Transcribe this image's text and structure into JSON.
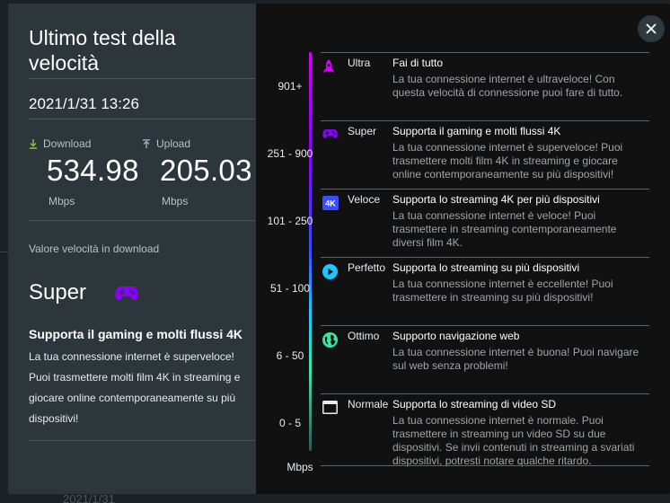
{
  "backdrop": {
    "date_text": "2021/1/31"
  },
  "summary": {
    "title": "Ultimo test della velocità",
    "timestamp": "2021/1/31 13:26",
    "download": {
      "label": "Download",
      "value": "534.98",
      "unit": "Mbps"
    },
    "upload": {
      "label": "Upload",
      "value": "205.03",
      "unit": "Mbps"
    },
    "section_label": "Valore velocità in download",
    "level_name": "Super",
    "level_title": "Supporta il gaming e molti flussi 4K",
    "level_description": "La tua connessione internet è superveloce! Puoi trasmettere molti film 4K in streaming e giocare online contemporaneamente su più dispositivi!"
  },
  "scale": {
    "labels": [
      "901+",
      "251 - 900",
      "101 - 250",
      "51 - 100",
      "6 - 50",
      "0 - 5"
    ],
    "unit": "Mbps"
  },
  "tiers": [
    {
      "name": "Ultra",
      "title": "Fai di tutto",
      "body": "La tua connessione internet è ultraveloce! Con questa velocità di connessione puoi fare di tutto.",
      "icon": "rocket-icon",
      "color": "#d400ff"
    },
    {
      "name": "Super",
      "title": "Supporta il gaming e molti flussi 4K",
      "body": "La tua connessione internet è superveloce! Puoi trasmettere molti film 4K in streaming e giocare online contemporaneamente su più dispositivi!",
      "icon": "gamepad-icon",
      "color": "#8a00ff"
    },
    {
      "name": "Veloce",
      "title": "Supporta lo streaming 4K per più dispositivi",
      "body": "La tua connessione internet è veloce! Puoi trasmettere in streaming contemporaneamente diversi film 4K.",
      "icon": "4k-icon",
      "icon_text": "4K",
      "color": "#3c4dff"
    },
    {
      "name": "Perfetto",
      "title": "Supporta lo streaming su più dispositivi",
      "body": "La tua connessione internet è eccellente! Puoi trasmettere in streaming su più dispositivi!",
      "icon": "play-icon",
      "color": "#1ec6ff"
    },
    {
      "name": "Ottimo",
      "title": "Supporto navigazione web",
      "body": "La tua connessione internet è buona! Puoi navigare sul web senza problemi!",
      "icon": "globe-icon",
      "color": "#38e6a6"
    },
    {
      "name": "Normale",
      "title": "Supporta lo streaming di video SD",
      "body": "La tua connessione internet è normale. Puoi trasmettere in streaming un video SD su due dispositivi. Se invii contenuti in streaming a svariati dispositivi, potresti notare qualche ritardo.",
      "icon": "browser-window-icon",
      "color": "#e8ecef"
    }
  ],
  "colors": {
    "panel_left": "#2c363b",
    "panel_right": "#111111",
    "download_arrow": "#8bc34a",
    "upload_arrow": "#8fb3c9",
    "level_icon": "#8a00ff"
  }
}
